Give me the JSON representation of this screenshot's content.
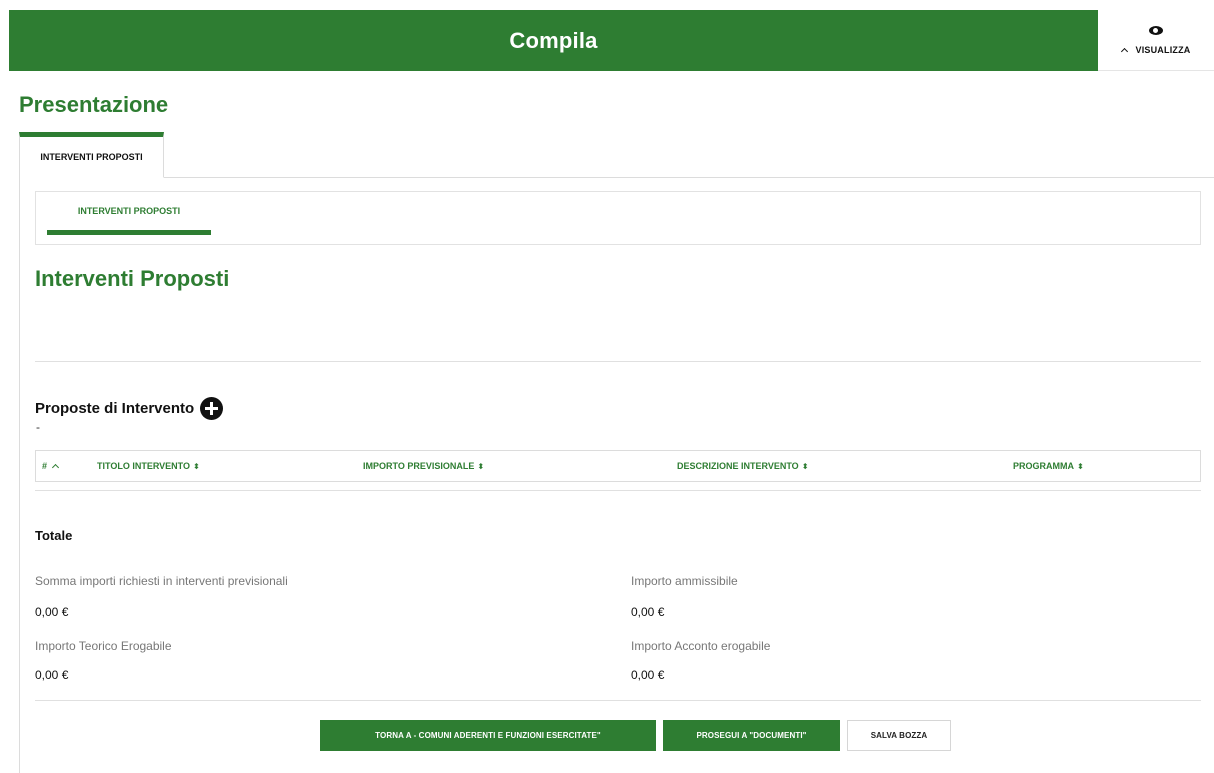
{
  "header": {
    "title": "Compila",
    "view_label": "VISUALIZZA",
    "view_icon": "eye-icon",
    "brand_color": "#2e7d32"
  },
  "page_title": "Presentazione",
  "outer_tabs": [
    {
      "label": "INTERVENTI PROPOSTI",
      "active": true
    }
  ],
  "inner_tabs": [
    {
      "label": "INTERVENTI PROPOSTI",
      "active": true
    }
  ],
  "section_title": "Interventi Proposti",
  "proposte": {
    "label": "Proposte di Intervento",
    "add_icon": "plus-circle-icon",
    "note": "-"
  },
  "table": {
    "columns": [
      {
        "label": "#",
        "sort": "up"
      },
      {
        "label": "TITOLO INTERVENTO",
        "sort": "both"
      },
      {
        "label": "IMPORTO PREVISIONALE",
        "sort": "both"
      },
      {
        "label": "DESCRIZIONE INTERVENTO",
        "sort": "both"
      },
      {
        "label": "PROGRAMMA",
        "sort": "both"
      }
    ],
    "sort_symbol": "⬍",
    "rows": []
  },
  "totale": {
    "title": "Totale",
    "fields": [
      {
        "label": "Somma importi richiesti in interventi previsionali",
        "value": "0,00 €"
      },
      {
        "label": "Importo ammissibile",
        "value": "0,00 €"
      },
      {
        "label": "Importo Teorico Erogabile",
        "value": "0,00 €"
      },
      {
        "label": "Importo Acconto erogabile",
        "value": "0,00 €"
      }
    ]
  },
  "buttons": {
    "back": "TORNA A - COMUNI ADERENTI E FUNZIONI ESERCITATE\"",
    "next": "PROSEGUI A \"DOCUMENTI\"",
    "draft": "SALVA BOZZA"
  }
}
